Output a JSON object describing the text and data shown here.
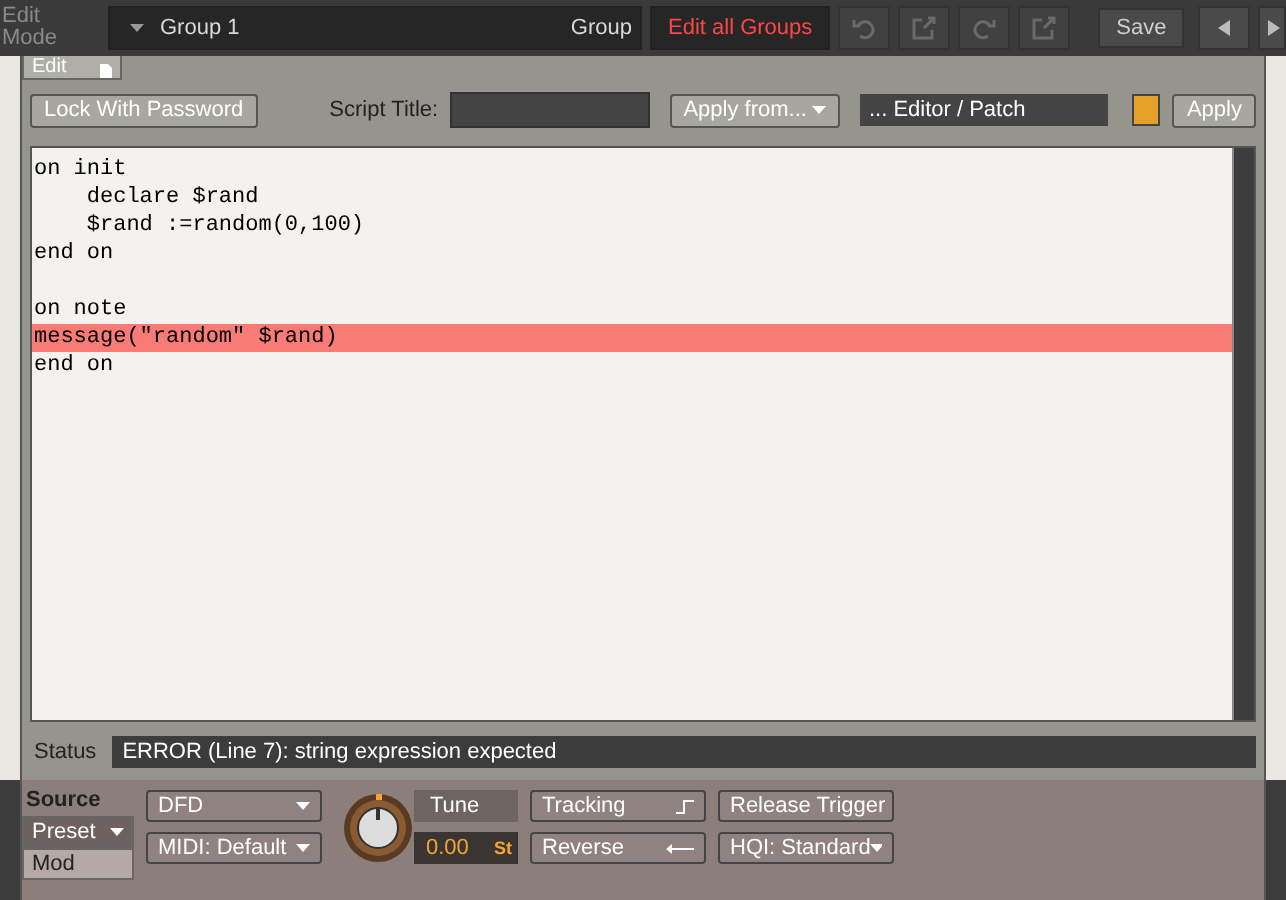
{
  "header": {
    "mode_label": "Edit Mode",
    "group_name": "Group 1",
    "group_label": "Group",
    "edit_all_label": "Edit all Groups",
    "edit_all_on": true,
    "save": "Save"
  },
  "tab": {
    "label": "Edit"
  },
  "toolbar": {
    "lock": "Lock With Password",
    "title_label": "Script Title:",
    "apply_from": "Apply from...",
    "source": "... Editor / Patch",
    "apply": "Apply"
  },
  "code": [
    {
      "kind": "code",
      "text": "on init",
      "error": false
    },
    {
      "kind": "code",
      "text": "    declare $rand",
      "error": false
    },
    {
      "kind": "code",
      "text": "    $rand :=random(0,100)",
      "error": false
    },
    {
      "kind": "code",
      "text": "end on",
      "error": false
    },
    {
      "kind": "blank"
    },
    {
      "kind": "code",
      "text": "on note",
      "error": false
    },
    {
      "kind": "code",
      "text": "message(\"random\" $rand)",
      "error": true
    },
    {
      "kind": "code",
      "text": "end on",
      "error": false
    }
  ],
  "status": {
    "label": "Status",
    "message": "ERROR (Line 7): string expression expected"
  },
  "source": {
    "title": "Source",
    "tabs": [
      {
        "label": "Preset",
        "selected": false
      },
      {
        "label": "Mod",
        "selected": true
      }
    ],
    "dfd": "DFD",
    "midi": "MIDI: Default",
    "tune_label": "Tune",
    "tune_value": "0.00",
    "tune_unit": "St",
    "tracking": "Tracking",
    "reverse": "Reverse",
    "release": "Release Trigger",
    "hqi": "HQI: Standard"
  }
}
